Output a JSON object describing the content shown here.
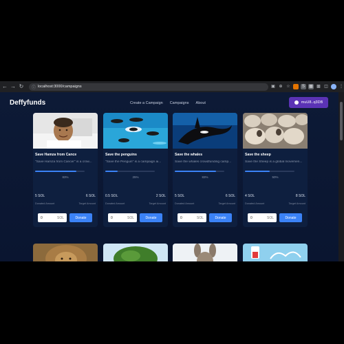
{
  "browser": {
    "url": "localhost:3000/campaigns"
  },
  "app": {
    "brand": "Deffyfunds",
    "nav": [
      "Create a Campaign",
      "Campaigns",
      "About"
    ],
    "wallet_label": "muU8..q3DB"
  },
  "campaigns": [
    {
      "title": "Save Hamza from Cance",
      "desc": "\"Save Hamza from Cancer\" is a crow...",
      "progress": 83,
      "progress_label": "83%",
      "raised": "5 SOL",
      "target": "6 SOL",
      "raised_label": "Donated Amount",
      "target_label": "Target Amount",
      "amount": "0",
      "unit": "SOL",
      "donate": "Donate"
    },
    {
      "title": "Save the penguins",
      "desc": "\"Save the Penguin\" is a campaign ai...",
      "progress": 25,
      "progress_label": "25%",
      "raised": "0.5 SOL",
      "target": "2 SOL",
      "raised_label": "Donated Amount",
      "target_label": "Target Amount",
      "amount": "0",
      "unit": "SOL",
      "donate": "Donate"
    },
    {
      "title": "Save the whales",
      "desc": "Save the whales crowdfunding camp...",
      "progress": 83,
      "progress_label": "83%",
      "raised": "5 SOL",
      "target": "6 SOL",
      "raised_label": "Donated Amount",
      "target_label": "Target Amount",
      "amount": "0",
      "unit": "SOL",
      "donate": "Donate"
    },
    {
      "title": "Save the sheep",
      "desc": "Save the Sheep is a global movemen...",
      "progress": 50,
      "progress_label": "50%",
      "raised": "4 SOL",
      "target": "8 SOL",
      "raised_label": "Donated Amount",
      "target_label": "Target Amount",
      "amount": "0",
      "unit": "SOL",
      "donate": "Donate"
    }
  ],
  "colors": {
    "background": "#0b1730",
    "card": "#0e1f3f",
    "accent": "#3b82f6",
    "wallet": "#5b33b5"
  }
}
